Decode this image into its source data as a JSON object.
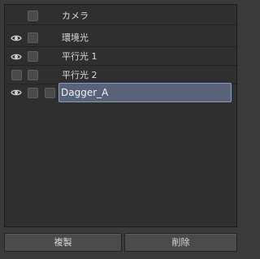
{
  "rows": [
    {
      "label": "カメラ",
      "visible": false
    },
    {
      "label": "環境光",
      "visible": true
    },
    {
      "label": "平行光 1",
      "visible": true
    },
    {
      "label": "平行光 2",
      "visible": false
    },
    {
      "label": "Dagger_A",
      "visible": true,
      "selected": true
    }
  ],
  "buttons": {
    "duplicate": "複製",
    "delete": "削除"
  },
  "icons": {
    "visibility": "eye-icon"
  }
}
